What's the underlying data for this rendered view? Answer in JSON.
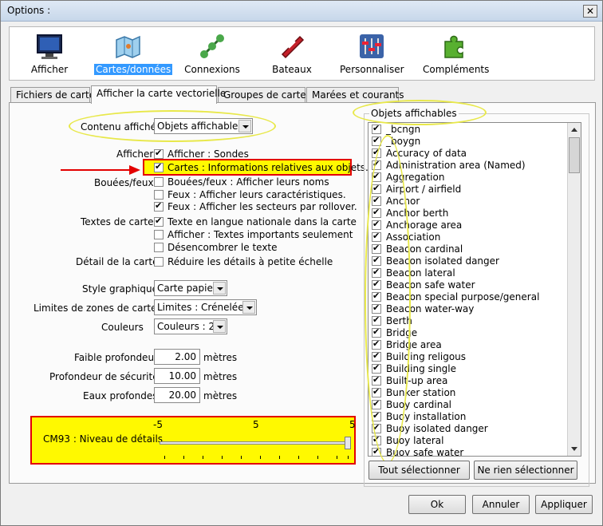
{
  "window": {
    "title": "Options :",
    "close_glyph": "✕"
  },
  "toolbar": [
    {
      "label": "Afficher",
      "icon": "monitor-icon"
    },
    {
      "label": "Cartes/données",
      "icon": "charts-icon"
    },
    {
      "label": "Connexions",
      "icon": "connections-icon"
    },
    {
      "label": "Bateaux",
      "icon": "boat-icon"
    },
    {
      "label": "Personnaliser",
      "icon": "sliders-icon"
    },
    {
      "label": "Compléments",
      "icon": "puzzle-icon"
    }
  ],
  "tabs": [
    "Fichiers de carte",
    "Afficher la carte vectorielle",
    "Groupes de cartes",
    "Marées et courants"
  ],
  "form": {
    "contenu_label": "Contenu affiché",
    "contenu_value": "Objets affichables",
    "afficher_label": "Afficher",
    "afficher_sondes": "Afficher : Sondes",
    "cartes_info": "Cartes : Informations relatives aux objets.",
    "bouees_label": "Bouées/feux",
    "bouees_noms": "Bouées/feux : Afficher leurs noms",
    "feux_carac": "Feux : Afficher leurs caractéristiques.",
    "feux_secteurs": "Feux : Afficher les secteurs par rollover.",
    "textes_label": "Textes de carte",
    "textes_langue": "Texte en langue nationale dans la carte",
    "textes_importants": "Afficher : Textes importants seulement",
    "desencombrer": "Désencombrer le texte",
    "detail_label": "Détail de la carte",
    "reduire": "Réduire les détails à petite échelle",
    "style_label": "Style graphique",
    "style_value": "Carte papier",
    "limites_label": "Limites de zones de cartes",
    "limites_value": "Limites : Crénelées",
    "couleurs_label": "Couleurs",
    "couleurs_value": "Couleurs : 2",
    "faible_label": "Faible profondeur",
    "faible_value": "2.00",
    "securite_label": "Profondeur de sécurité",
    "securite_value": "10.00",
    "profondes_label": "Eaux profondes",
    "profondes_value": "20.00",
    "unit": "mètres",
    "cm93_label": "CM93 : Niveau de détails",
    "cm93_min": "-5",
    "cm93_mid": "5",
    "cm93_max": "5",
    "cm93_level": 1.0
  },
  "objects": {
    "group_label": "Objets affichables",
    "items": [
      "_bcngn",
      "_boygn",
      "Accuracy of data",
      "Administration area (Named)",
      "Aggregation",
      "Airport / airfield",
      "Anchor",
      "Anchor berth",
      "Anchorage area",
      "Association",
      "Beacon cardinal",
      "Beacon isolated danger",
      "Beacon lateral",
      "Beacon safe water",
      "Beacon special purpose/general",
      "Beacon water-way",
      "Berth",
      "Bridge",
      "Bridge area",
      "Building religous",
      "Building single",
      "Built-up area",
      "Bunker station",
      "Buoy cardinal",
      "Buoy installation",
      "Buoy isolated danger",
      "Buoy lateral",
      "Buoy safe water"
    ],
    "select_all": "Tout sélectionner",
    "select_none": "Ne rien sélectionner"
  },
  "footer": {
    "ok": "Ok",
    "cancel": "Annuler",
    "apply": "Appliquer"
  },
  "colors": {
    "highlight": "#fff900",
    "highlight_border": "#e30000",
    "ellipse": "#e8e84a",
    "selection": "#3399ff"
  }
}
